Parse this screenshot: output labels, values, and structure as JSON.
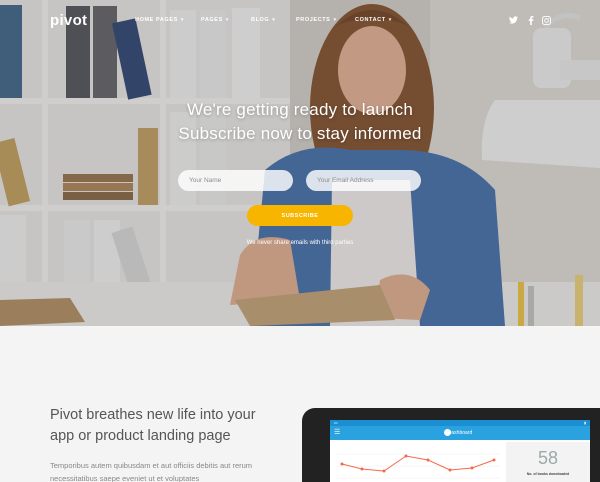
{
  "nav": {
    "logo": "pivot",
    "menu": [
      {
        "label": "HOME PAGES"
      },
      {
        "label": "PAGES"
      },
      {
        "label": "BLOG"
      },
      {
        "label": "PROJECTS"
      },
      {
        "label": "CONTACT"
      }
    ],
    "social": [
      "twitter-icon",
      "facebook-icon",
      "instagram-icon"
    ]
  },
  "hero": {
    "headline_1": "We're getting ready to launch",
    "headline_2": "Subscribe now to stay informed",
    "name_placeholder": "Your Name",
    "email_placeholder": "Your Email Address",
    "subscribe_label": "SUBSCRIBE",
    "privacy_note": "We never share emails with third parties"
  },
  "colors": {
    "accent": "#f7b500",
    "app_blue": "#2ba2e0",
    "chart_line": "#f26a4b"
  },
  "feature": {
    "title": "Pivot breathes new life into your app or product landing page",
    "body": "Temporibus autem quibusdam et aut officiis debitis aut rerum necessitatibus saepe eveniet ut et voluptates"
  },
  "tablet": {
    "app_title": "Dashboard",
    "stat_value": "58",
    "stat_label": "No. of books downloaded"
  }
}
